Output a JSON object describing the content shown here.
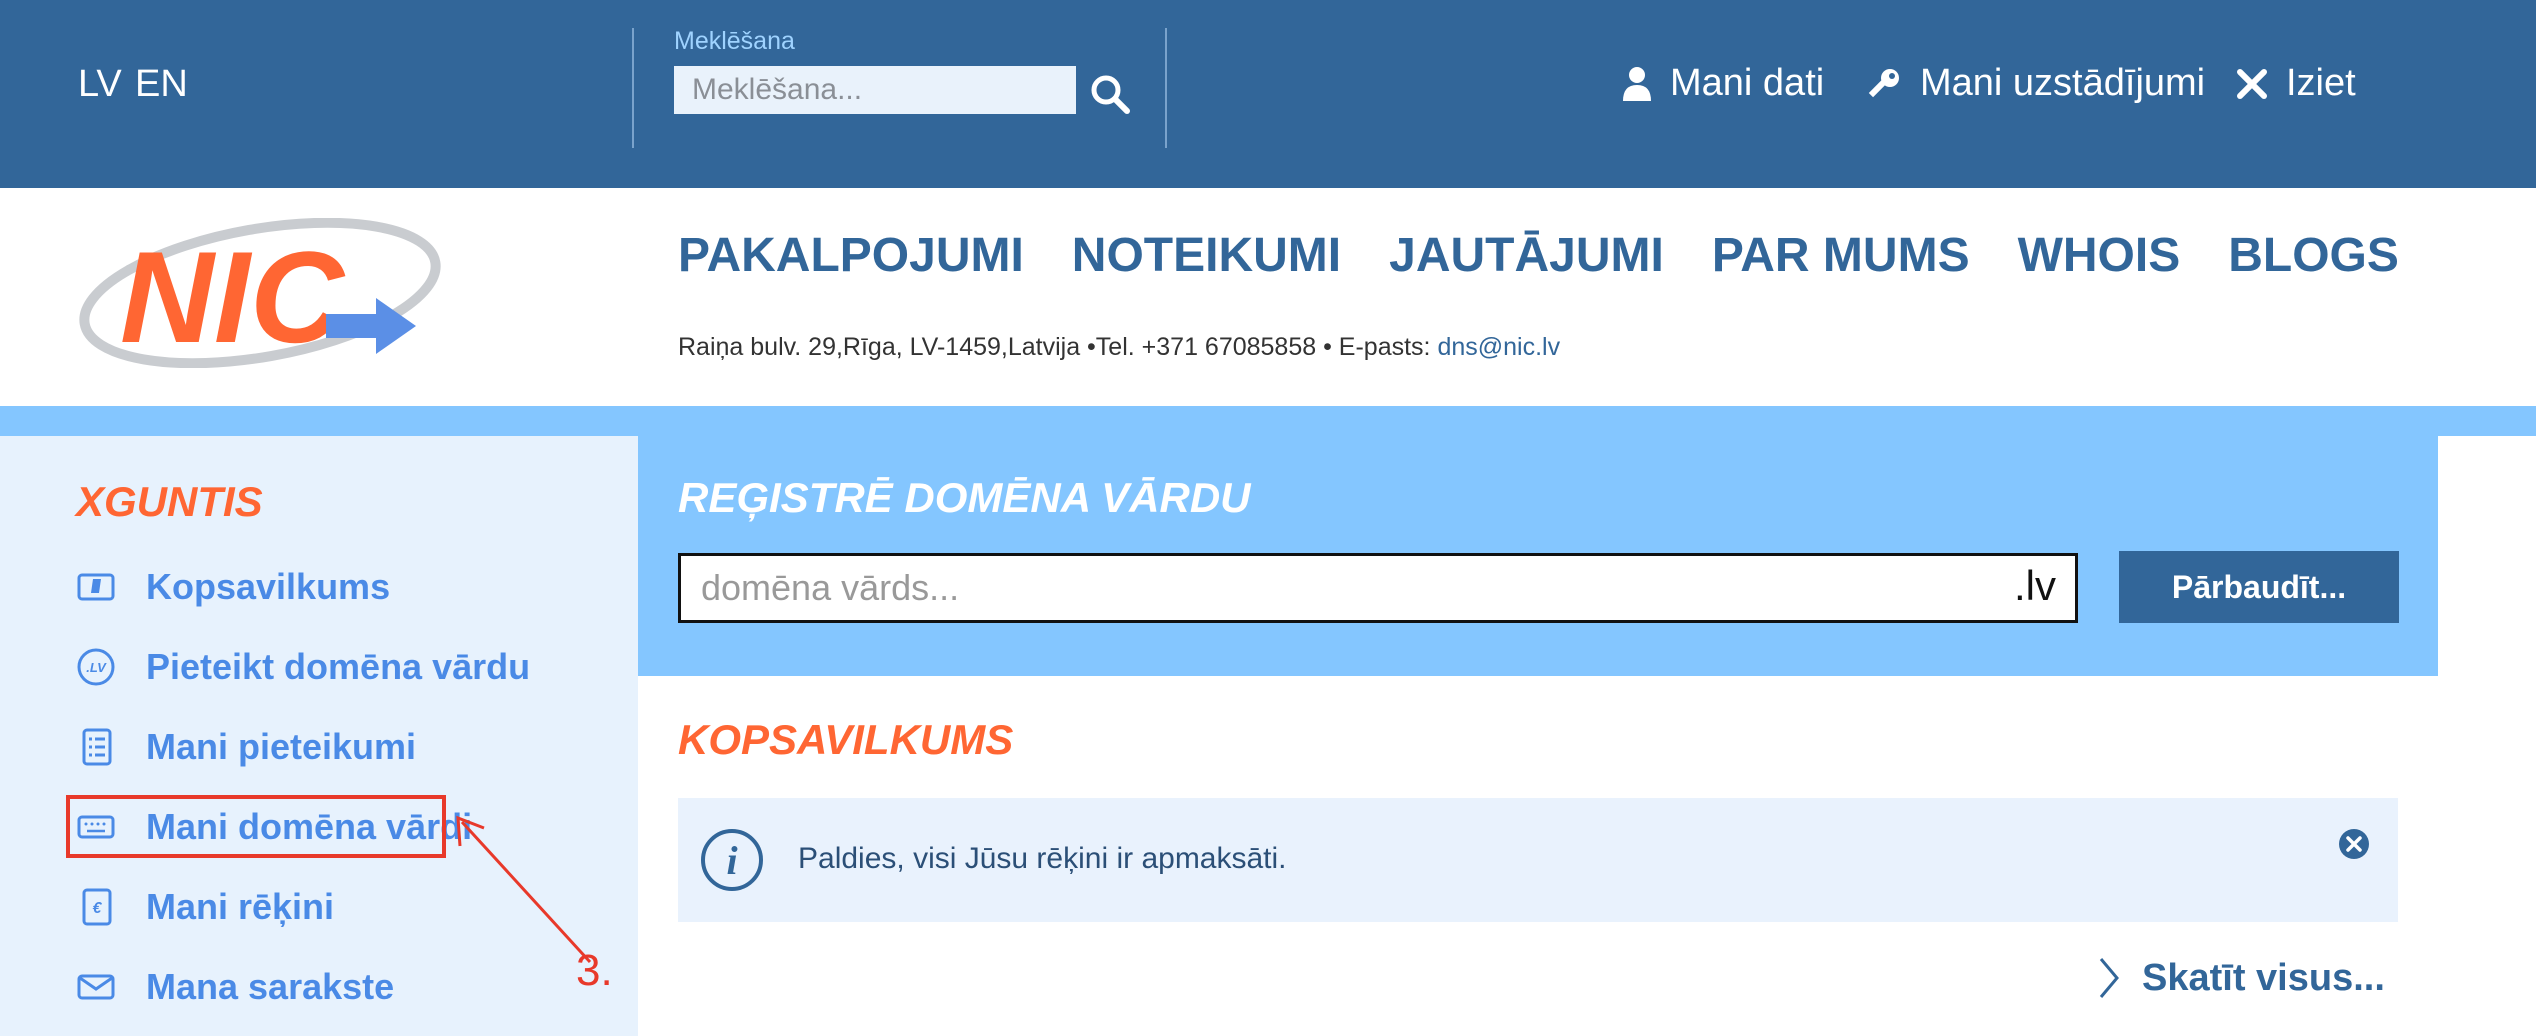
{
  "top": {
    "languages": [
      "LV",
      "EN"
    ],
    "search_label": "Meklēšana",
    "search_placeholder": "Meklēšana...",
    "links": {
      "my_data": "Mani dati",
      "my_settings": "Mani uzstādījumi",
      "logout": "Iziet"
    }
  },
  "header": {
    "logo_text": "NIC",
    "nav": [
      "PAKALPOJUMI",
      "NOTEIKUMI",
      "JAUTĀJUMI",
      "PAR MUMS",
      "WHOIS",
      "BLOGS"
    ],
    "address_prefix": "Raiņa bulv. 29,Rīga, LV-1459,Latvija •Tel. +371 67085858 • E-pasts: ",
    "email": "dns@nic.lv"
  },
  "sidebar": {
    "user": "XGUNTIS",
    "items": [
      {
        "label": "Kopsavilkums",
        "icon": "dashboard-icon"
      },
      {
        "label": "Pieteikt domēna vārdu",
        "icon": "lv-domain-icon"
      },
      {
        "label": "Mani pieteikumi",
        "icon": "list-icon"
      },
      {
        "label": "Mani domēna vārdi",
        "icon": "keyboard-icon"
      },
      {
        "label": "Mani rēķini",
        "icon": "euro-doc-icon"
      },
      {
        "label": "Mana sarakste",
        "icon": "envelope-icon"
      }
    ]
  },
  "annotation": {
    "step": "3.",
    "color": "#e8392a"
  },
  "register": {
    "title": "REĢISTRĒ DOMĒNA VĀRDU",
    "placeholder": "domēna vārds...",
    "tld": ".lv",
    "button": "Pārbaudīt..."
  },
  "summary": {
    "title": "KOPSAVILKUMS",
    "message": "Paldies, visi Jūsu rēķini ir apmaksāti.",
    "view_all": "Skatīt visus..."
  },
  "colors": {
    "top_bar": "#326699",
    "accent_orange": "#ff6633",
    "light_blue": "#84c6ff",
    "sidebar_bg": "#e7f2fd",
    "link_blue": "#4a8ae6"
  }
}
